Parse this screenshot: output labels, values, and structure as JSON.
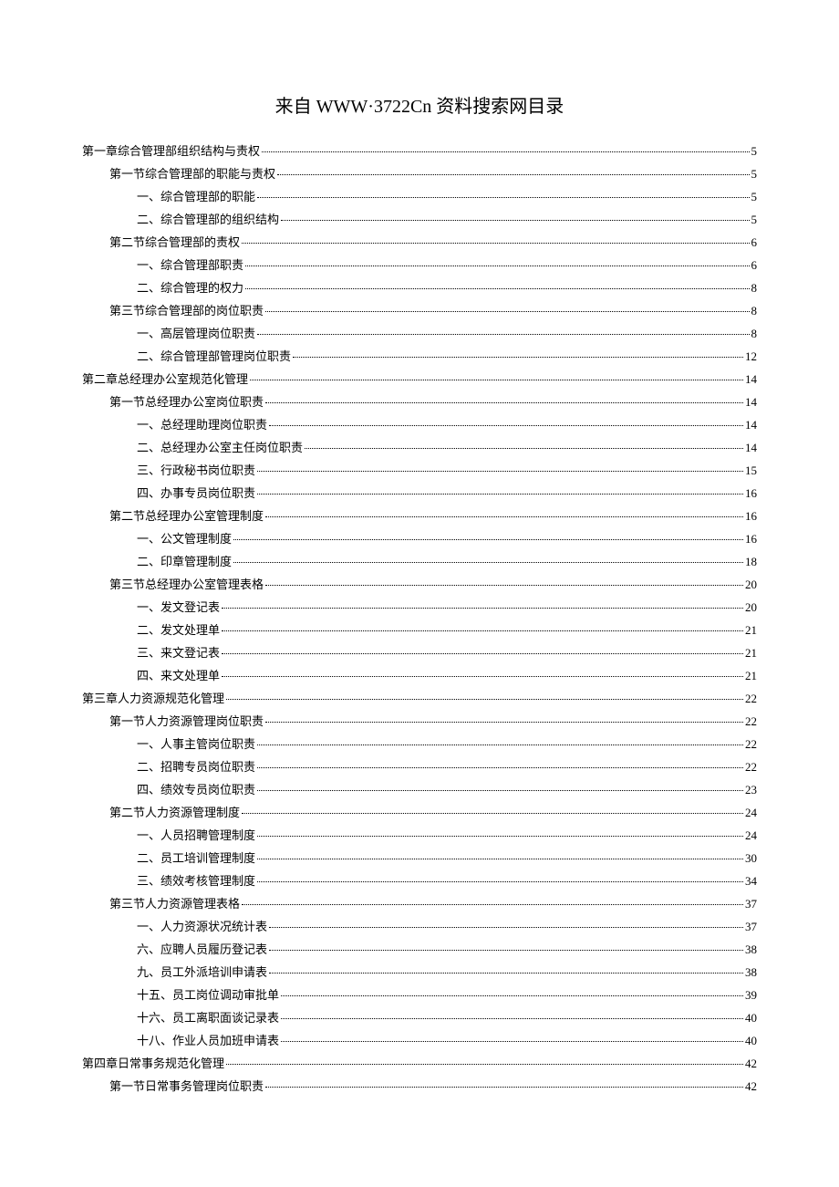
{
  "title": "来自 WWW·3722Cn 资料搜索网目录",
  "toc": [
    {
      "level": 0,
      "label": "第一章综合管理部组织结构与责权",
      "page": "5"
    },
    {
      "level": 1,
      "label": "第一节综合管理部的职能与责权",
      "page": "5"
    },
    {
      "level": 2,
      "label": "一、综合管理部的职能",
      "page": "5"
    },
    {
      "level": 2,
      "label": "二、综合管理部的组织结构",
      "page": "5"
    },
    {
      "level": 1,
      "label": "第二节综合管理部的责权",
      "page": "6"
    },
    {
      "level": 2,
      "label": "一、综合管理部职责",
      "page": "6"
    },
    {
      "level": 2,
      "label": "二、综合管理的权力",
      "page": "8"
    },
    {
      "level": 1,
      "label": "第三节综合管理部的岗位职责",
      "page": "8"
    },
    {
      "level": 2,
      "label": "一、高层管理岗位职责",
      "page": "8"
    },
    {
      "level": 2,
      "label": "二、综合管理部管理岗位职责",
      "page": "12"
    },
    {
      "level": 0,
      "label": "第二章总经理办公室规范化管理",
      "page": "14"
    },
    {
      "level": 1,
      "label": "第一节总经理办公室岗位职责",
      "page": "14"
    },
    {
      "level": 2,
      "label": "一、总经理助理岗位职责",
      "page": "14"
    },
    {
      "level": 2,
      "label": "二、总经理办公室主任岗位职责",
      "page": "14"
    },
    {
      "level": 2,
      "label": "三、行政秘书岗位职责",
      "page": "15"
    },
    {
      "level": 2,
      "label": "四、办事专员岗位职责",
      "page": "16"
    },
    {
      "level": 1,
      "label": "第二节总经理办公室管理制度",
      "page": "16"
    },
    {
      "level": 2,
      "label": "一、公文管理制度",
      "page": "16"
    },
    {
      "level": 2,
      "label": "二、印章管理制度",
      "page": "18"
    },
    {
      "level": 1,
      "label": "第三节总经理办公室管理表格",
      "page": "20"
    },
    {
      "level": 2,
      "label": "一、发文登记表",
      "page": "20"
    },
    {
      "level": 2,
      "label": "二、发文处理单",
      "page": "21"
    },
    {
      "level": 2,
      "label": "三、来文登记表",
      "page": "21"
    },
    {
      "level": 2,
      "label": "四、来文处理单",
      "page": "21"
    },
    {
      "level": 0,
      "label": "第三章人力资源规范化管理",
      "page": "22"
    },
    {
      "level": 1,
      "label": "第一节人力资源管理岗位职责",
      "page": "22"
    },
    {
      "level": 2,
      "label": "一、人事主管岗位职责",
      "page": "22"
    },
    {
      "level": 2,
      "label": "二、招聘专员岗位职责",
      "page": "22"
    },
    {
      "level": 2,
      "label": "四、绩效专员岗位职责",
      "page": "23"
    },
    {
      "level": 1,
      "label": "第二节人力资源管理制度",
      "page": "24"
    },
    {
      "level": 2,
      "label": "一、人员招聘管理制度",
      "page": "24"
    },
    {
      "level": 2,
      "label": "二、员工培训管理制度",
      "page": "30"
    },
    {
      "level": 2,
      "label": "三、绩效考核管理制度",
      "page": "34"
    },
    {
      "level": 1,
      "label": "第三节人力资源管理表格",
      "page": "37"
    },
    {
      "level": 2,
      "label": "一、人力资源状况统计表",
      "page": "37"
    },
    {
      "level": 2,
      "label": "六、应聘人员履历登记表",
      "page": "38"
    },
    {
      "level": 2,
      "label": "九、员工外派培训申请表",
      "page": "38"
    },
    {
      "level": 2,
      "label": "十五、员工岗位调动审批单",
      "page": "39"
    },
    {
      "level": 2,
      "label": "十六、员工离职面谈记录表",
      "page": "40"
    },
    {
      "level": 2,
      "label": "十八、作业人员加班申请表",
      "page": "40"
    },
    {
      "level": 0,
      "label": "第四章日常事务规范化管理",
      "page": "42"
    },
    {
      "level": 1,
      "label": "第一节日常事务管理岗位职责",
      "page": "42"
    }
  ]
}
